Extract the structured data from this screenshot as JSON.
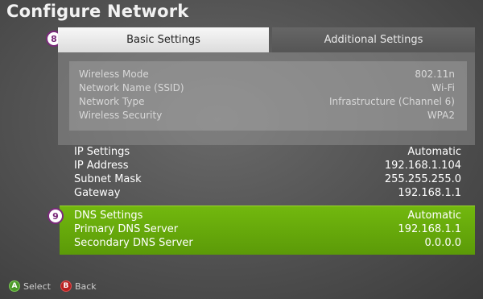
{
  "page": {
    "title": "Configure Network"
  },
  "tabs": {
    "basic": "Basic Settings",
    "additional": "Additional Settings"
  },
  "callouts": {
    "first": "8",
    "second": "9"
  },
  "wireless": [
    {
      "label": "Wireless Mode",
      "value": "802.11n"
    },
    {
      "label": "Network Name (SSID)",
      "value": "Wi-Fi"
    },
    {
      "label": "Network Type",
      "value": "Infrastructure (Channel 6)"
    },
    {
      "label": "Wireless Security",
      "value": "WPA2"
    }
  ],
  "ip": [
    {
      "label": "IP Settings",
      "value": "Automatic"
    },
    {
      "label": "IP Address",
      "value": "192.168.1.104"
    },
    {
      "label": "Subnet Mask",
      "value": "255.255.255.0"
    },
    {
      "label": "Gateway",
      "value": "192.168.1.1"
    }
  ],
  "dns": [
    {
      "label": "DNS Settings",
      "value": "Automatic"
    },
    {
      "label": "Primary DNS Server",
      "value": "192.168.1.1"
    },
    {
      "label": "Secondary DNS Server",
      "value": "0.0.0.0"
    }
  ],
  "footer": {
    "a_glyph": "A",
    "select_label": "Select",
    "b_glyph": "B",
    "back_label": "Back"
  },
  "colors": {
    "dns_highlight": "#6aab0b",
    "tab_active": "#efefef",
    "callout_border": "#7a2a7a"
  }
}
